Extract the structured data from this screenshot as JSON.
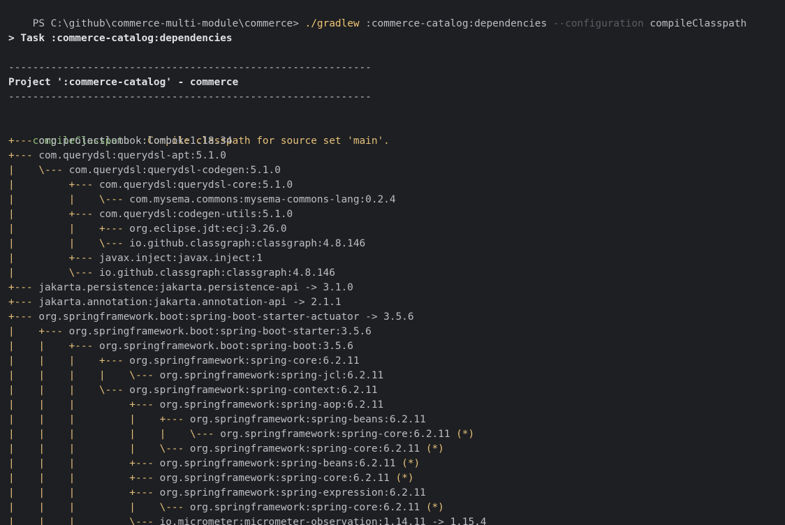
{
  "terminal": {
    "prompt": "PS C:\\github\\commerce-multi-module\\commerce> ",
    "command": {
      "gradlew": "./gradlew",
      "task": " :commerce-catalog:dependencies ",
      "flag": "--configuration",
      "config": " compileClasspath"
    },
    "task_line": "> Task :commerce-catalog:dependencies",
    "separator": "------------------------------------------------------------",
    "project_line": "Project ':commerce-catalog' - commerce",
    "config_name": "compileClasspath",
    "config_desc": " - Compile classpath for source set 'main'.",
    "deps": [
      {
        "tree": "+--- ",
        "text": "org.projectlombok:lombok:1.18.34",
        "star": ""
      },
      {
        "tree": "+--- ",
        "text": "com.querydsl:querydsl-apt:5.1.0",
        "star": ""
      },
      {
        "tree": "|    \\--- ",
        "text": "com.querydsl:querydsl-codegen:5.1.0",
        "star": ""
      },
      {
        "tree": "|         +--- ",
        "text": "com.querydsl:querydsl-core:5.1.0",
        "star": ""
      },
      {
        "tree": "|         |    \\--- ",
        "text": "com.mysema.commons:mysema-commons-lang:0.2.4",
        "star": ""
      },
      {
        "tree": "|         +--- ",
        "text": "com.querydsl:codegen-utils:5.1.0",
        "star": ""
      },
      {
        "tree": "|         |    +--- ",
        "text": "org.eclipse.jdt:ecj:3.26.0",
        "star": ""
      },
      {
        "tree": "|         |    \\--- ",
        "text": "io.github.classgraph:classgraph:4.8.146",
        "star": ""
      },
      {
        "tree": "|         +--- ",
        "text": "javax.inject:javax.inject:1",
        "star": ""
      },
      {
        "tree": "|         \\--- ",
        "text": "io.github.classgraph:classgraph:4.8.146",
        "star": ""
      },
      {
        "tree": "+--- ",
        "text": "jakarta.persistence:jakarta.persistence-api -> 3.1.0",
        "star": ""
      },
      {
        "tree": "+--- ",
        "text": "jakarta.annotation:jakarta.annotation-api -> 2.1.1",
        "star": ""
      },
      {
        "tree": "+--- ",
        "text": "org.springframework.boot:spring-boot-starter-actuator -> 3.5.6",
        "star": ""
      },
      {
        "tree": "|    +--- ",
        "text": "org.springframework.boot:spring-boot-starter:3.5.6",
        "star": ""
      },
      {
        "tree": "|    |    +--- ",
        "text": "org.springframework.boot:spring-boot:3.5.6",
        "star": ""
      },
      {
        "tree": "|    |    |    +--- ",
        "text": "org.springframework:spring-core:6.2.11",
        "star": ""
      },
      {
        "tree": "|    |    |    |    \\--- ",
        "text": "org.springframework:spring-jcl:6.2.11",
        "star": ""
      },
      {
        "tree": "|    |    |    \\--- ",
        "text": "org.springframework:spring-context:6.2.11",
        "star": ""
      },
      {
        "tree": "|    |    |         +--- ",
        "text": "org.springframework:spring-aop:6.2.11",
        "star": ""
      },
      {
        "tree": "|    |    |         |    +--- ",
        "text": "org.springframework:spring-beans:6.2.11",
        "star": ""
      },
      {
        "tree": "|    |    |         |    |    \\--- ",
        "text": "org.springframework:spring-core:6.2.11",
        "star": " (*)"
      },
      {
        "tree": "|    |    |         |    \\--- ",
        "text": "org.springframework:spring-core:6.2.11",
        "star": " (*)"
      },
      {
        "tree": "|    |    |         +--- ",
        "text": "org.springframework:spring-beans:6.2.11",
        "star": " (*)"
      },
      {
        "tree": "|    |    |         +--- ",
        "text": "org.springframework:spring-core:6.2.11",
        "star": " (*)"
      },
      {
        "tree": "|    |    |         +--- ",
        "text": "org.springframework:spring-expression:6.2.11",
        "star": ""
      },
      {
        "tree": "|    |    |         |    \\--- ",
        "text": "org.springframework:spring-core:6.2.11",
        "star": " (*)"
      },
      {
        "tree": "|    |    |         \\--- ",
        "text": "io.micrometer:micrometer-observation:1.14.11 -> 1.15.4",
        "star": ""
      }
    ],
    "colors": {
      "background": "#1e1f22",
      "text": "#bcbec4",
      "tree": "#e5c07b",
      "config_name": "#8ec07c",
      "flag": "#5a5d63"
    }
  }
}
